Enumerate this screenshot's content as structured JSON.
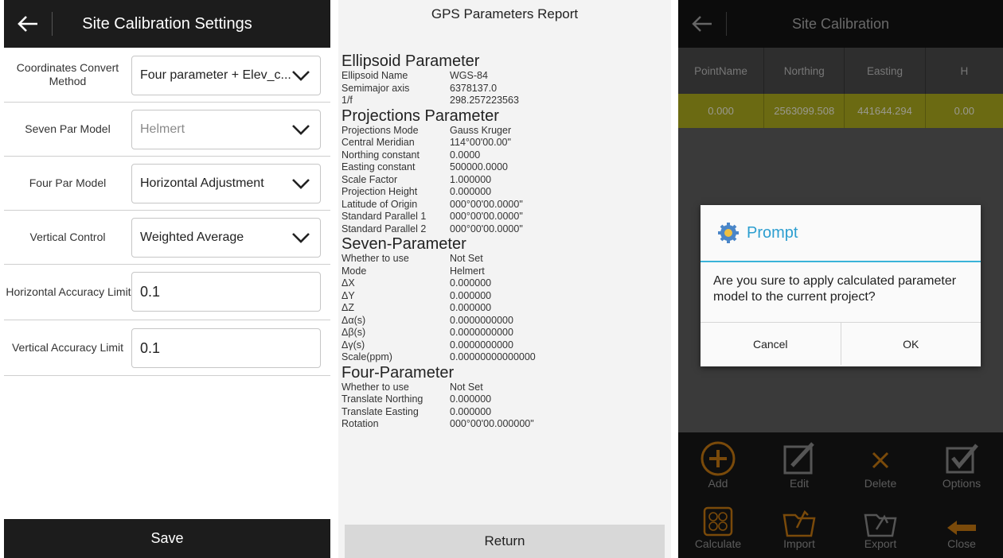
{
  "panel1": {
    "title": "Site Calibration Settings",
    "rows": [
      {
        "label": "Coordinates Convert Method",
        "value": "Four parameter + Elev_c..."
      },
      {
        "label": "Seven Par Model",
        "value": "Helmert"
      },
      {
        "label": "Four Par Model",
        "value": "Horizontal Adjustment"
      },
      {
        "label": "Vertical Control",
        "value": "Weighted Average"
      },
      {
        "label": "Horizontal Accuracy Limit",
        "value": "0.1"
      },
      {
        "label": "Vertical Accuracy Limit",
        "value": "0.1"
      }
    ],
    "save_label": "Save"
  },
  "report": {
    "title": "GPS Parameters Report",
    "ellipsoid": {
      "heading": "Ellipsoid Parameter",
      "rows": [
        {
          "k": "Ellipsoid Name",
          "v": "WGS-84"
        },
        {
          "k": "Semimajor axis",
          "v": "6378137.0"
        },
        {
          "k": "1/f",
          "v": "298.257223563"
        }
      ]
    },
    "projection": {
      "heading": "Projections Parameter",
      "rows": [
        {
          "k": "Projections Mode",
          "v": "Gauss Kruger"
        },
        {
          "k": "Central Meridian",
          "v": "114°00'00.00\""
        },
        {
          "k": "Northing constant",
          "v": "0.0000"
        },
        {
          "k": "Easting constant",
          "v": "500000.0000"
        },
        {
          "k": "Scale Factor",
          "v": "1.000000"
        },
        {
          "k": "Projection Height",
          "v": "0.000000"
        },
        {
          "k": "Latitude of Origin",
          "v": "000°00'00.0000\""
        },
        {
          "k": "Standard Parallel 1",
          "v": "000°00'00.0000\""
        },
        {
          "k": "Standard Parallel 2",
          "v": "000°00'00.0000\""
        }
      ]
    },
    "seven": {
      "heading": "Seven-Parameter",
      "rows": [
        {
          "k": "Whether to use",
          "v": "Not Set"
        },
        {
          "k": "Mode",
          "v": "Helmert"
        },
        {
          "k": "ΔX",
          "v": "0.000000"
        },
        {
          "k": "ΔY",
          "v": "0.000000"
        },
        {
          "k": "ΔZ",
          "v": "0.000000"
        },
        {
          "k": "Δα(s)",
          "v": "0.0000000000"
        },
        {
          "k": "Δβ(s)",
          "v": "0.0000000000"
        },
        {
          "k": "Δγ(s)",
          "v": "0.0000000000"
        },
        {
          "k": "Scale(ppm)",
          "v": "0.00000000000000"
        }
      ]
    },
    "four": {
      "heading": "Four-Parameter",
      "rows": [
        {
          "k": "Whether to use",
          "v": "Not Set"
        },
        {
          "k": "Translate Northing",
          "v": "0.000000"
        },
        {
          "k": "Translate Easting",
          "v": "0.000000"
        },
        {
          "k": "Rotation",
          "v": "000°00'00.000000\""
        }
      ]
    },
    "return_label": "Return"
  },
  "panel3": {
    "title": "Site Calibration",
    "columns": [
      "PointName",
      "Northing",
      "Easting",
      "H"
    ],
    "row": [
      "0.000",
      "2563099.508",
      "441644.294",
      "0.00"
    ],
    "tools": [
      {
        "label": "Add",
        "icon": "add-icon"
      },
      {
        "label": "Edit",
        "icon": "edit-icon"
      },
      {
        "label": "Delete",
        "icon": "delete-icon"
      },
      {
        "label": "Options",
        "icon": "options-icon"
      },
      {
        "label": "Calculate",
        "icon": "calculator-icon"
      },
      {
        "label": "Import",
        "icon": "import-folder-icon"
      },
      {
        "label": "Export",
        "icon": "export-folder-icon"
      },
      {
        "label": "Close",
        "icon": "close-arrow-icon"
      }
    ],
    "dialog": {
      "title": "Prompt",
      "message": "Are you sure to apply calculated parameter model to the current project?",
      "cancel": "Cancel",
      "ok": "OK"
    },
    "accent": "#e89a1a"
  }
}
